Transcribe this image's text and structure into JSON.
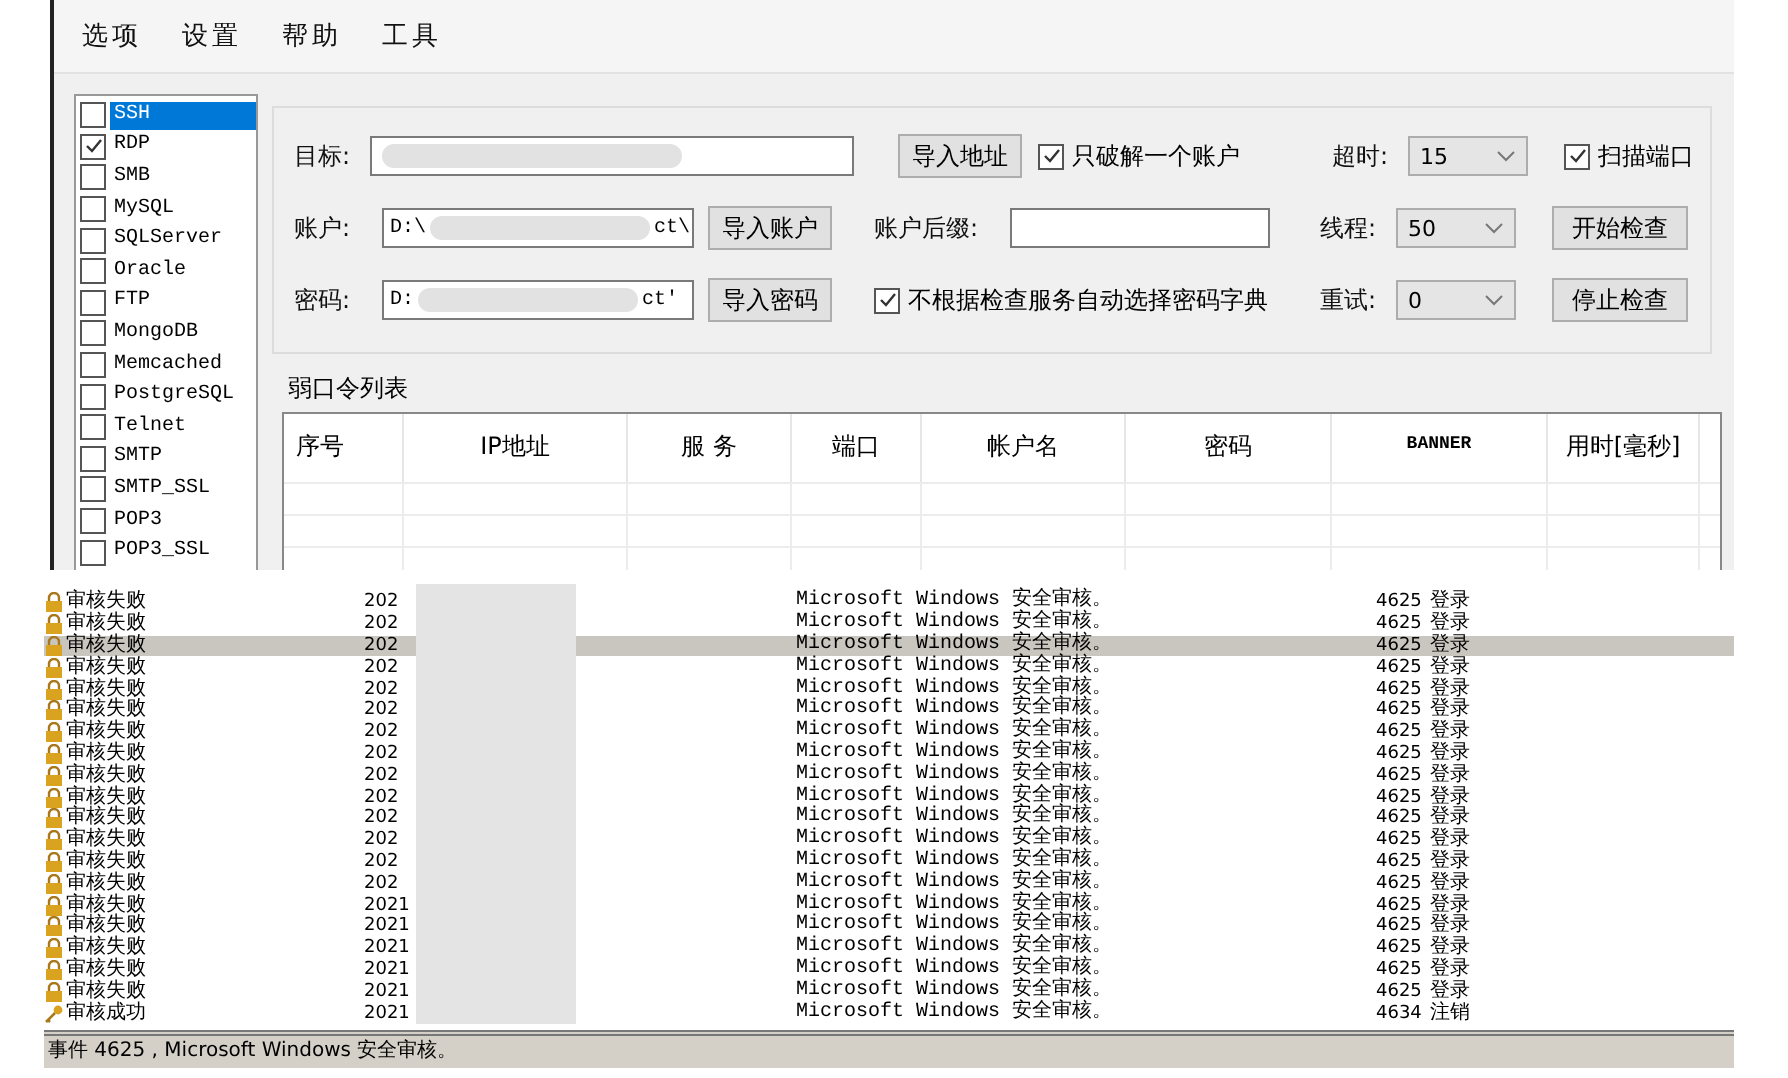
{
  "menu": [
    "选项",
    "设置",
    "帮助",
    "工具"
  ],
  "protocols": [
    {
      "label": "SSH",
      "checked": false,
      "selected": true
    },
    {
      "label": "RDP",
      "checked": true,
      "selected": false
    },
    {
      "label": "SMB",
      "checked": false,
      "selected": false
    },
    {
      "label": "MySQL",
      "checked": false,
      "selected": false
    },
    {
      "label": "SQLServer",
      "checked": false,
      "selected": false
    },
    {
      "label": "Oracle",
      "checked": false,
      "selected": false
    },
    {
      "label": "FTP",
      "checked": false,
      "selected": false
    },
    {
      "label": "MongoDB",
      "checked": false,
      "selected": false
    },
    {
      "label": "Memcached",
      "checked": false,
      "selected": false
    },
    {
      "label": "PostgreSQL",
      "checked": false,
      "selected": false
    },
    {
      "label": "Telnet",
      "checked": false,
      "selected": false
    },
    {
      "label": "SMTP",
      "checked": false,
      "selected": false
    },
    {
      "label": "SMTP_SSL",
      "checked": false,
      "selected": false
    },
    {
      "label": "POP3",
      "checked": false,
      "selected": false
    },
    {
      "label": "POP3_SSL",
      "checked": false,
      "selected": false
    }
  ],
  "form": {
    "target": {
      "label": "目标:"
    },
    "account": {
      "label": "账户:",
      "value_start": "D:\\",
      "value_end": "ct\\"
    },
    "password": {
      "label": "密码:",
      "value_start": "D:",
      "value_end": "ct'"
    },
    "import_address": "导入地址",
    "import_account": "导入账户",
    "import_password": "导入密码",
    "crack_one": {
      "label": "只破解一个账户",
      "checked": true
    },
    "suffix": {
      "label": "账户后缀:"
    },
    "no_auto_dict": {
      "label": "不根据检查服务自动选择密码字典",
      "checked": true
    },
    "timeout": {
      "label": "超时:",
      "value": "15"
    },
    "threads": {
      "label": "线程:",
      "value": "50"
    },
    "retry": {
      "label": "重试:",
      "value": "0"
    },
    "scan_ports": {
      "label": "扫描端口",
      "checked": true
    },
    "start": "开始检查",
    "stop": "停止检查"
  },
  "results": {
    "title": "弱口令列表",
    "columns": [
      "序号",
      "IP地址",
      "服 务",
      "端口",
      "帐户名",
      "密码",
      "BANNER",
      "用时[毫秒]"
    ]
  },
  "event_log": {
    "rows": [
      {
        "kind": "failure",
        "type": "审核失败",
        "date": "202",
        "source": "Microsoft Windows 安全审核。",
        "event_id": "4625",
        "category": "登录",
        "selected": false
      },
      {
        "kind": "failure",
        "type": "审核失败",
        "date": "202",
        "source": "Microsoft Windows 安全审核。",
        "event_id": "4625",
        "category": "登录",
        "selected": false
      },
      {
        "kind": "failure",
        "type": "审核失败",
        "date": "202",
        "source": "Microsoft Windows 安全审核。",
        "event_id": "4625",
        "category": "登录",
        "selected": true
      },
      {
        "kind": "failure",
        "type": "审核失败",
        "date": "202",
        "source": "Microsoft Windows 安全审核。",
        "event_id": "4625",
        "category": "登录",
        "selected": false
      },
      {
        "kind": "failure",
        "type": "审核失败",
        "date": "202",
        "source": "Microsoft Windows 安全审核。",
        "event_id": "4625",
        "category": "登录",
        "selected": false
      },
      {
        "kind": "failure",
        "type": "审核失败",
        "date": "202",
        "source": "Microsoft Windows 安全审核。",
        "event_id": "4625",
        "category": "登录",
        "selected": false
      },
      {
        "kind": "failure",
        "type": "审核失败",
        "date": "202",
        "source": "Microsoft Windows 安全审核。",
        "event_id": "4625",
        "category": "登录",
        "selected": false
      },
      {
        "kind": "failure",
        "type": "审核失败",
        "date": "202",
        "source": "Microsoft Windows 安全审核。",
        "event_id": "4625",
        "category": "登录",
        "selected": false
      },
      {
        "kind": "failure",
        "type": "审核失败",
        "date": "202",
        "source": "Microsoft Windows 安全审核。",
        "event_id": "4625",
        "category": "登录",
        "selected": false
      },
      {
        "kind": "failure",
        "type": "审核失败",
        "date": "202",
        "source": "Microsoft Windows 安全审核。",
        "event_id": "4625",
        "category": "登录",
        "selected": false
      },
      {
        "kind": "failure",
        "type": "审核失败",
        "date": "202",
        "source": "Microsoft Windows 安全审核。",
        "event_id": "4625",
        "category": "登录",
        "selected": false
      },
      {
        "kind": "failure",
        "type": "审核失败",
        "date": "202",
        "source": "Microsoft Windows 安全审核。",
        "event_id": "4625",
        "category": "登录",
        "selected": false
      },
      {
        "kind": "failure",
        "type": "审核失败",
        "date": "202",
        "source": "Microsoft Windows 安全审核。",
        "event_id": "4625",
        "category": "登录",
        "selected": false
      },
      {
        "kind": "failure",
        "type": "审核失败",
        "date": "202",
        "source": "Microsoft Windows 安全审核。",
        "event_id": "4625",
        "category": "登录",
        "selected": false
      },
      {
        "kind": "failure",
        "type": "审核失败",
        "date": "2021",
        "source": "Microsoft Windows 安全审核。",
        "event_id": "4625",
        "category": "登录",
        "selected": false
      },
      {
        "kind": "failure",
        "type": "审核失败",
        "date": "2021",
        "source": "Microsoft Windows 安全审核。",
        "event_id": "4625",
        "category": "登录",
        "selected": false
      },
      {
        "kind": "failure",
        "type": "审核失败",
        "date": "2021",
        "source": "Microsoft Windows 安全审核。",
        "event_id": "4625",
        "category": "登录",
        "selected": false
      },
      {
        "kind": "failure",
        "type": "审核失败",
        "date": "2021",
        "source": "Microsoft Windows 安全审核。",
        "event_id": "4625",
        "category": "登录",
        "selected": false
      },
      {
        "kind": "failure",
        "type": "审核失败",
        "date": "2021",
        "source": "Microsoft Windows 安全审核。",
        "event_id": "4625",
        "category": "登录",
        "selected": false
      },
      {
        "kind": "success",
        "type": "审核成功",
        "date": "2021",
        "source": "Microsoft Windows 安全审核。",
        "event_id": "4634",
        "category": "注销",
        "selected": false
      }
    ],
    "status_bar": "事件 4625 , Microsoft Windows 安全审核。"
  }
}
